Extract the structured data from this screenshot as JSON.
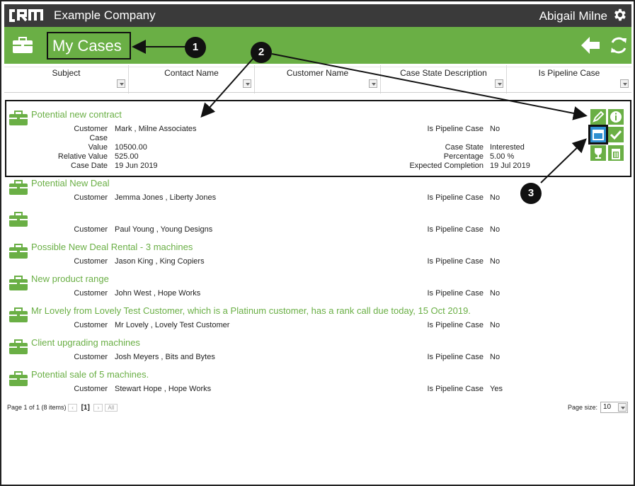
{
  "app": {
    "logo_text": "CRM",
    "company": "Example Company",
    "user": "Abigail Milne"
  },
  "header": {
    "title": "My Cases"
  },
  "columns": [
    "Subject",
    "Contact Name",
    "Customer Name",
    "Case State Description",
    "Is Pipeline Case"
  ],
  "labels": {
    "customer": "Customer",
    "case": "Case",
    "value": "Value",
    "relative_value": "Relative Value",
    "case_date": "Case Date",
    "is_pipeline": "Is Pipeline Case",
    "case_state": "Case State",
    "percentage": "Percentage",
    "expected_completion": "Expected Completion"
  },
  "cases": [
    {
      "title": "Potential new contract",
      "customer": "Mark , Milne Associates",
      "pipeline": "No",
      "value": "10500.00",
      "relative_value": "525.00",
      "case_date": "19 Jun 2019",
      "case_state": "Interested",
      "percentage": "5.00 %",
      "expected_completion": "19 Jul 2019"
    },
    {
      "title": "Potential New Deal",
      "customer": "Jemma Jones , Liberty Jones",
      "pipeline": "No"
    },
    {
      "title": "",
      "customer": "Paul Young , Young Designs",
      "pipeline": "No"
    },
    {
      "title": "Possible New Deal Rental - 3 machines",
      "customer": "Jason King , King Copiers",
      "pipeline": "No"
    },
    {
      "title": "New product range",
      "customer": "John West , Hope Works",
      "pipeline": "No"
    },
    {
      "title": "Mr Lovely from Lovely Test Customer, which is a Platinum customer, has a rank call due today, 15 Oct 2019.",
      "customer": "Mr Lovely , Lovely Test Customer",
      "pipeline": "No"
    },
    {
      "title": "Client upgrading machines",
      "customer": "Josh Meyers , Bits and Bytes",
      "pipeline": "No"
    },
    {
      "title": "Potential sale of 5 machines.",
      "customer": "Stewart Hope , Hope Works",
      "pipeline": "Yes"
    }
  ],
  "pager": {
    "info": "Page 1 of 1 (8 items)",
    "current": "[1]",
    "all": "All",
    "page_size_label": "Page size:",
    "page_size": "10"
  },
  "callouts": [
    "1",
    "2",
    "3"
  ],
  "colors": {
    "green": "#6aaf45",
    "dark": "#3a3a3a"
  }
}
